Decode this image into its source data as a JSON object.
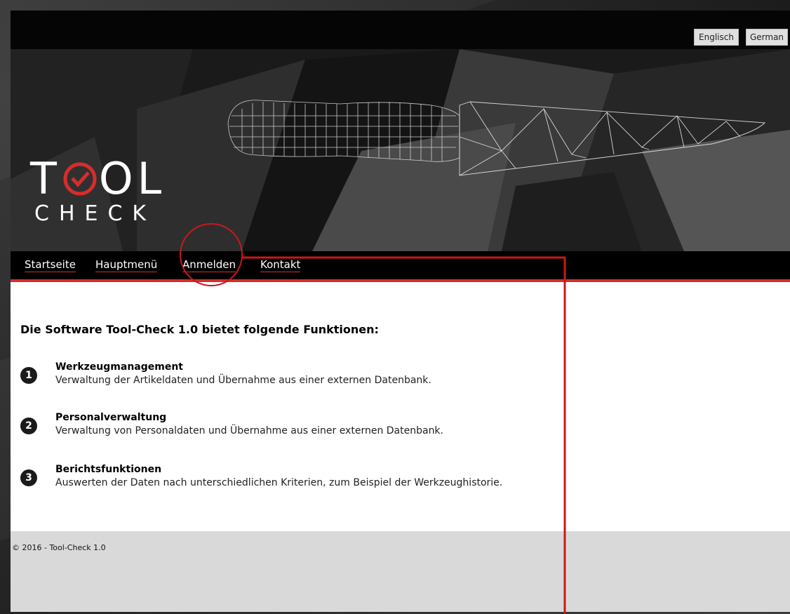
{
  "lang": {
    "english_label": "Englisch",
    "german_label": "German"
  },
  "logo": {
    "line1": "TOOL",
    "line2": "CHECK",
    "check_icon": "checkmark-circle-icon"
  },
  "nav": [
    {
      "label": "Startseite"
    },
    {
      "label": "Hauptmenü"
    },
    {
      "label": "Anmelden"
    },
    {
      "label": "Kontakt"
    }
  ],
  "content": {
    "heading": "Die Software Tool-Check 1.0 bietet folgende Funktionen:",
    "features": [
      {
        "number": "1",
        "title": "Werkzeugmanagement",
        "description": "Verwaltung der Artikeldaten und Übernahme aus einer externen Datenbank."
      },
      {
        "number": "2",
        "title": "Personalverwaltung",
        "description": "Verwaltung von Personaldaten und Übernahme aus einer externen Datenbank."
      },
      {
        "number": "3",
        "title": "Berichtsfunktionen",
        "description": "Auswerten der Daten nach unterschiedlichen Kriterien, zum Beispiel der Werkzeughistorie."
      }
    ]
  },
  "footer": {
    "copyright": "© 2016 - Tool-Check 1.0"
  },
  "colors": {
    "accent": "#d82c2c",
    "header_bg": "#000000",
    "footer_bg": "#d9d9d9"
  },
  "annotation": {
    "target": "Anmelden",
    "shape": "circle-with-connector-line",
    "color": "#c8181e"
  }
}
